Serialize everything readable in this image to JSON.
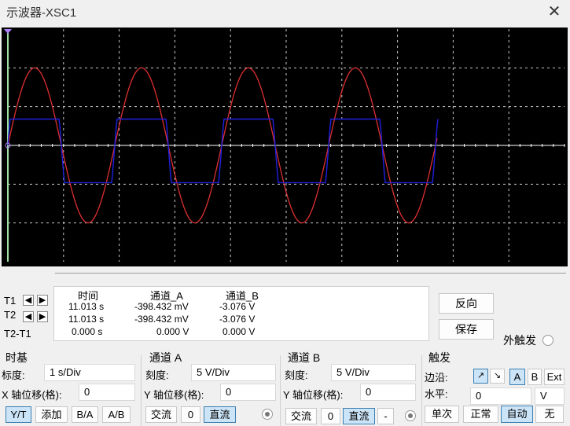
{
  "window": {
    "title": "示波器-XSC1",
    "close_glyph": "✕"
  },
  "screen": {
    "background": "#000000",
    "grid_color": "#c8c8c8",
    "axis_color": "#ffffff",
    "cursor_color": "#a0e0a0",
    "channel_a_color": "#e03030",
    "channel_b_color": "#2020e0"
  },
  "readout": {
    "headers": [
      "时间",
      "通道_A",
      "通道_B"
    ],
    "rows": [
      {
        "label": "T1",
        "time": "11.013 s",
        "a": "-398.432 mV",
        "b": "-3.076 V"
      },
      {
        "label": "T2",
        "time": "11.013 s",
        "a": "-398.432 mV",
        "b": "-3.076 V"
      },
      {
        "label": "T2-T1",
        "time": "0.000 s",
        "a": "0.000 V",
        "b": "0.000 V"
      }
    ]
  },
  "buttons": {
    "reverse": "反向",
    "save": "保存",
    "ext_trigger": "外触发"
  },
  "timebase": {
    "title": "时基",
    "scale_label": "标度:",
    "scale_value": "1  s/Div",
    "xpos_label": "X 轴位移(格):",
    "xpos_value": "0",
    "modes": [
      "Y/T",
      "添加",
      "B/A",
      "A/B"
    ],
    "selected_mode": "Y/T"
  },
  "channel_a": {
    "title": "通道 A",
    "scale_label": "刻度:",
    "scale_value": "5  V/Div",
    "ypos_label": "Y 轴位移(格):",
    "ypos_value": "0",
    "coupling": [
      "交流",
      "0",
      "直流"
    ],
    "selected": "直流"
  },
  "channel_b": {
    "title": "通道 B",
    "scale_label": "刻度:",
    "scale_value": "5  V/Div",
    "ypos_label": "Y 轴位移(格):",
    "ypos_value": "0",
    "coupling": [
      "交流",
      "0",
      "直流",
      "-"
    ],
    "selected": "直流"
  },
  "trigger": {
    "title": "触发",
    "edge_label": "边沿:",
    "edge_buttons": [
      "A",
      "B",
      "Ext"
    ],
    "selected_source": "A",
    "level_label": "水平:",
    "level_value": "0",
    "level_unit": "V",
    "modes": [
      "单次",
      "正常",
      "自动",
      "无"
    ],
    "selected_mode": "自动"
  }
}
